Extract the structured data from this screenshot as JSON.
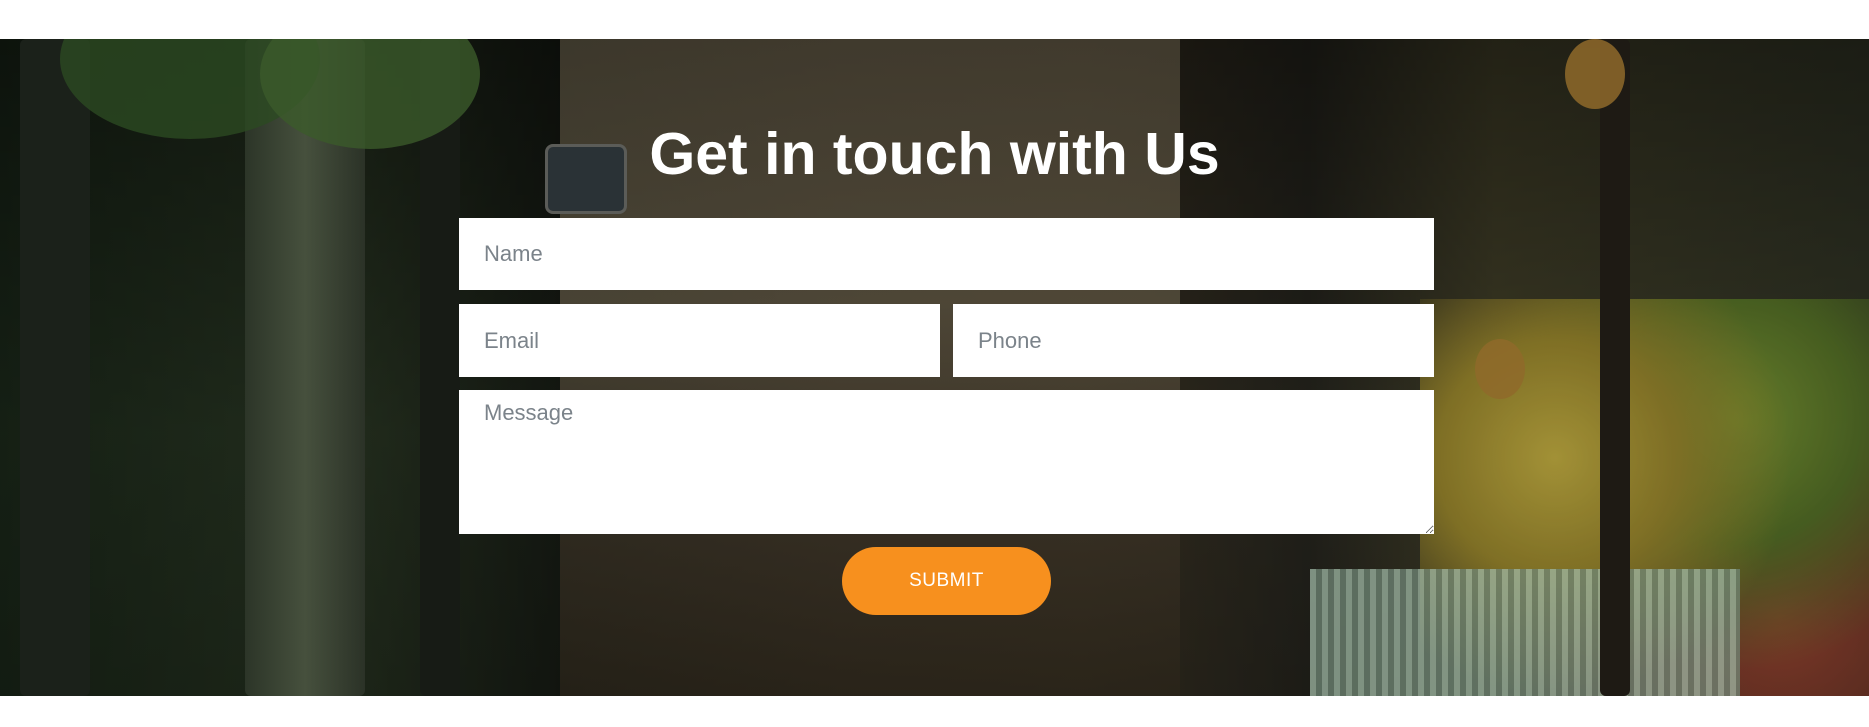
{
  "contact": {
    "title": "Get in touch with Us",
    "name_placeholder": "Name",
    "email_placeholder": "Email",
    "phone_placeholder": "Phone",
    "message_placeholder": "Message",
    "submit_label": "SUBMIT"
  },
  "colors": {
    "button": "#f7901e",
    "title": "#ffffff",
    "field_bg": "#ffffff",
    "placeholder": "#7b838a"
  }
}
